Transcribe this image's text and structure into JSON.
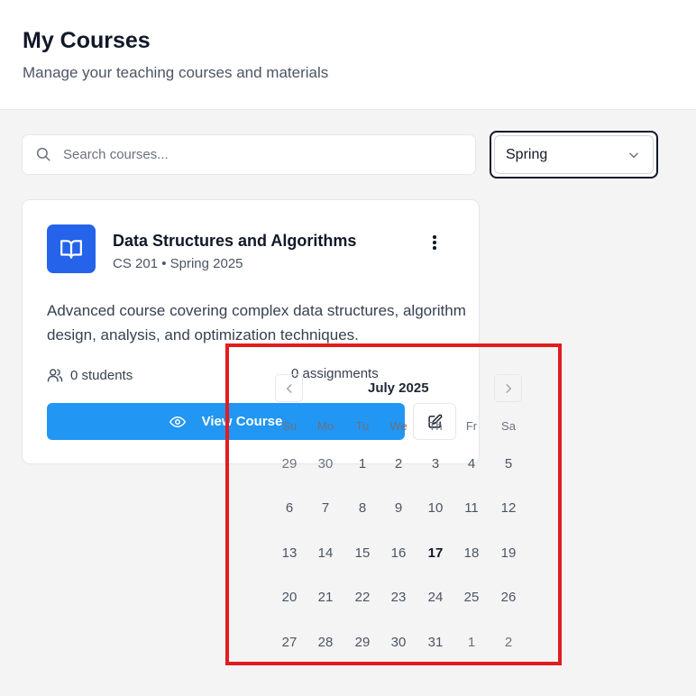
{
  "header": {
    "title": "My Courses",
    "subtitle": "Manage your teaching courses and materials"
  },
  "search": {
    "placeholder": "Search courses...",
    "icon": "search-icon"
  },
  "term_filter": {
    "selected": "Spring"
  },
  "course": {
    "title": "Data Structures and Algorithms",
    "meta": "CS 201 • Spring 2025",
    "description": "Advanced course covering complex data structures, algorithm design, analysis, and optimization techniques.",
    "students": "0 students",
    "assignments": "0 assignments",
    "view_label": "View Course",
    "icon_color": "#2563eb",
    "button_color": "#2196f3"
  },
  "calendar": {
    "month": "July 2025",
    "weekdays": [
      "Su",
      "Mo",
      "Tu",
      "We",
      "Th",
      "Fr",
      "Sa"
    ],
    "weeks": [
      [
        "29",
        "30",
        "1",
        "2",
        "3",
        "4",
        "5"
      ],
      [
        "6",
        "7",
        "8",
        "9",
        "10",
        "11",
        "12"
      ],
      [
        "13",
        "14",
        "15",
        "16",
        "17",
        "18",
        "19"
      ],
      [
        "20",
        "21",
        "22",
        "23",
        "24",
        "25",
        "26"
      ],
      [
        "27",
        "28",
        "29",
        "30",
        "31",
        "1",
        "2"
      ]
    ],
    "today": "17",
    "highlight_color": "#e11d1d"
  }
}
